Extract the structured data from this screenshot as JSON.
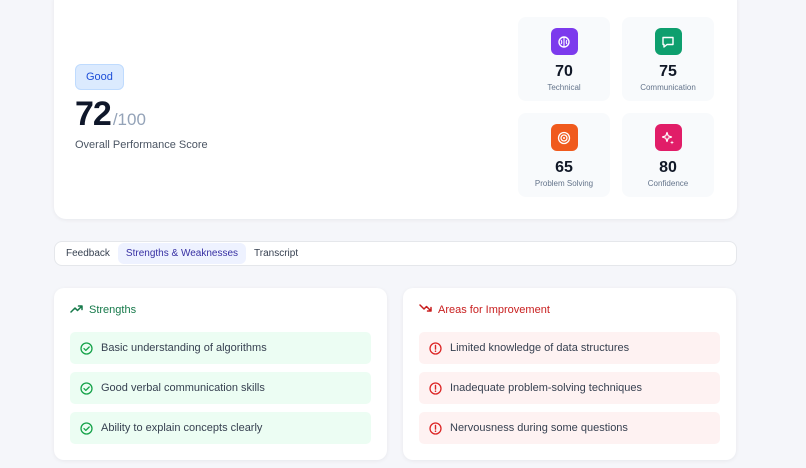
{
  "overview": {
    "badge": "Good",
    "score": "72",
    "score_max": "/100",
    "score_label": "Overall Performance Score"
  },
  "metrics": [
    {
      "value": "70",
      "label": "Technical",
      "icon": "brain-icon",
      "color": "#7c3aed"
    },
    {
      "value": "75",
      "label": "Communication",
      "icon": "chat-icon",
      "color": "#0e9f6e"
    },
    {
      "value": "65",
      "label": "Problem Solving",
      "icon": "target-icon",
      "color": "#f05a1d"
    },
    {
      "value": "80",
      "label": "Confidence",
      "icon": "sparkle-icon",
      "color": "#e11d68"
    }
  ],
  "tabs": [
    {
      "label": "Feedback",
      "active": false
    },
    {
      "label": "Strengths & Weaknesses",
      "active": true
    },
    {
      "label": "Transcript",
      "active": false
    }
  ],
  "strengths": {
    "title": "Strengths",
    "color": "#16794a",
    "items": [
      "Basic understanding of algorithms",
      "Good verbal communication skills",
      "Ability to explain concepts clearly"
    ]
  },
  "improvements": {
    "title": "Areas for Improvement",
    "color": "#c81e1e",
    "items": [
      "Limited knowledge of data structures",
      "Inadequate problem-solving techniques",
      "Nervousness during some questions"
    ]
  }
}
